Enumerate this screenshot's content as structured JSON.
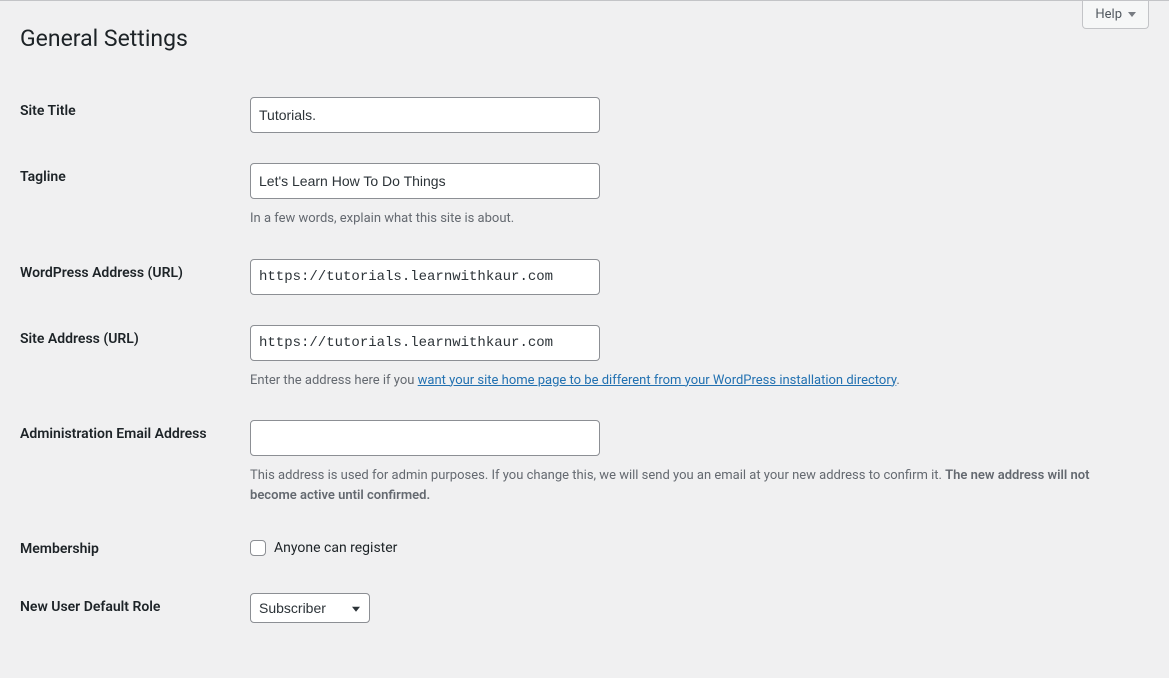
{
  "help": {
    "label": "Help"
  },
  "page": {
    "title": "General Settings"
  },
  "fields": {
    "site_title": {
      "label": "Site Title",
      "value": "Tutorials."
    },
    "tagline": {
      "label": "Tagline",
      "value": "Let's Learn How To Do Things",
      "description": "In a few words, explain what this site is about."
    },
    "wp_url": {
      "label": "WordPress Address (URL)",
      "value": "https://tutorials.learnwithkaur.com"
    },
    "site_url": {
      "label": "Site Address (URL)",
      "value": "https://tutorials.learnwithkaur.com",
      "desc_prefix": "Enter the address here if you ",
      "desc_link": "want your site home page to be different from your WordPress installation directory",
      "desc_suffix": "."
    },
    "admin_email": {
      "label": "Administration Email Address",
      "value": "",
      "desc_before": "This address is used for admin purposes. If you change this, we will send you an email at your new address to confirm it. ",
      "desc_bold": "The new address will not become active until confirmed."
    },
    "membership": {
      "label": "Membership",
      "checkbox_label": "Anyone can register",
      "checked": false
    },
    "default_role": {
      "label": "New User Default Role",
      "selected": "Subscriber"
    }
  }
}
